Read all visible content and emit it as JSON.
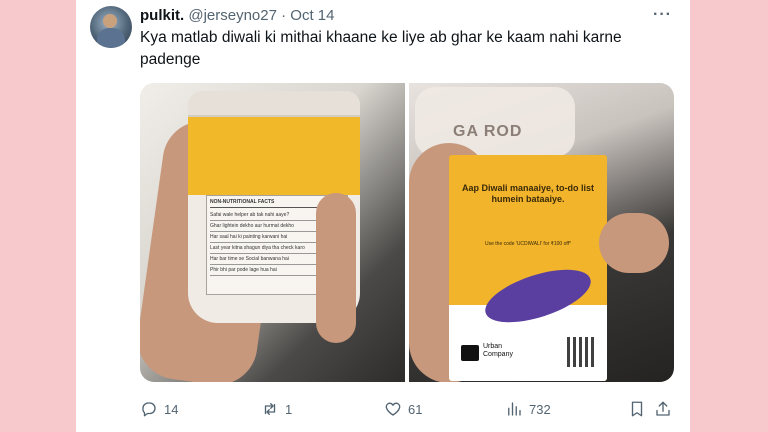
{
  "tweet": {
    "display_name": "pulkit.",
    "handle": "@jerseyno27",
    "separator": "·",
    "date": "Oct 14",
    "more": "···",
    "text": "Kya matlab diwali ki mithai khaane ke liye ab ghar ke kaam nahi karne padenge"
  },
  "media": {
    "left_image": {
      "panel_header": "NON-NUTRITIONAL FACTS",
      "rows": [
        "Safai wale helper ab tak nahi aaye?",
        "Ghar lightein dekho aur hurmat dekho",
        "Har saal hai ki painting karwani hai",
        "Last year kitna shagun diya tha check karo",
        "Har bar time se Social banwana hai",
        "Phir bhi par pode lage hua hai"
      ]
    },
    "right_image": {
      "bag_text": "GA ROD",
      "flyer_title": "Aap Diwali manaaiye, to-do list humein bataaiye.",
      "flyer_code": "Use the code 'UCDIWALI' for ₹100 off*",
      "brand_line1": "Urban",
      "brand_line2": "Company"
    }
  },
  "actions": {
    "replies": "14",
    "reposts": "1",
    "likes": "61",
    "views": "732"
  },
  "colors": {
    "background": "#f7c9cc",
    "text_primary": "#0f1419",
    "text_secondary": "#536471",
    "flyer_yellow": "#f2b42a",
    "flyer_purple": "#5a3ea0"
  }
}
